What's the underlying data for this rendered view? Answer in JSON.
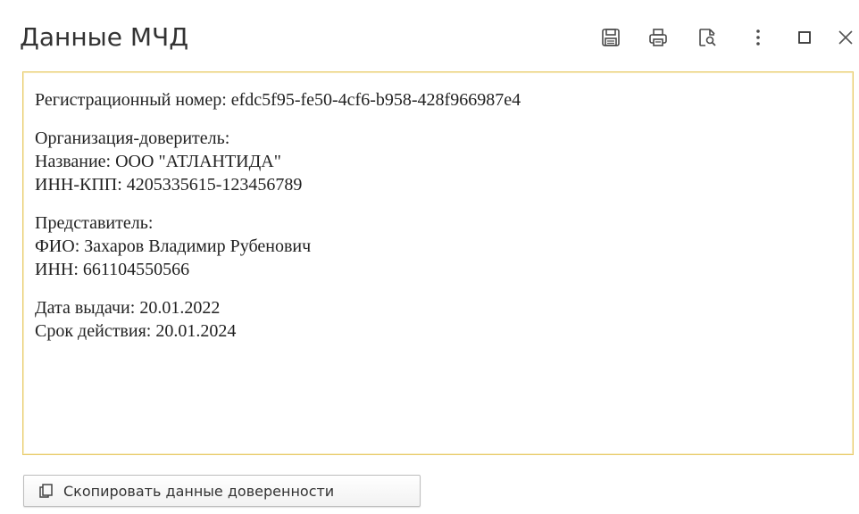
{
  "window": {
    "title": "Данные МЧД"
  },
  "toolbar": {
    "icons": [
      "save-icon",
      "print-icon",
      "print-preview-icon",
      "more-icon",
      "maximize-icon",
      "close-icon"
    ]
  },
  "memo": {
    "registration_line": "Регистрационный номер: efdc5f95-fe50-4cf6-b958-428f966987e4",
    "principal_header": "Организация-доверитель:",
    "principal_name": "Название: ООО \"АТЛАНТИДА\"",
    "principal_inn_kpp": "ИНН-КПП: 4205335615-123456789",
    "representative_header": "Представитель:",
    "representative_name": "ФИО: Захаров Владимир Рубенович",
    "representative_inn": "ИНН: 661104550566",
    "issue_date": "Дата выдачи: 20.01.2022",
    "valid_until": "Срок действия: 20.01.2024"
  },
  "actions": {
    "copy_button_label": "Скопировать данные доверенности",
    "copy_button_icon": "copy-icon"
  },
  "colors": {
    "memo_border": "#e8cb6a",
    "text": "#222222",
    "title": "#333333"
  }
}
